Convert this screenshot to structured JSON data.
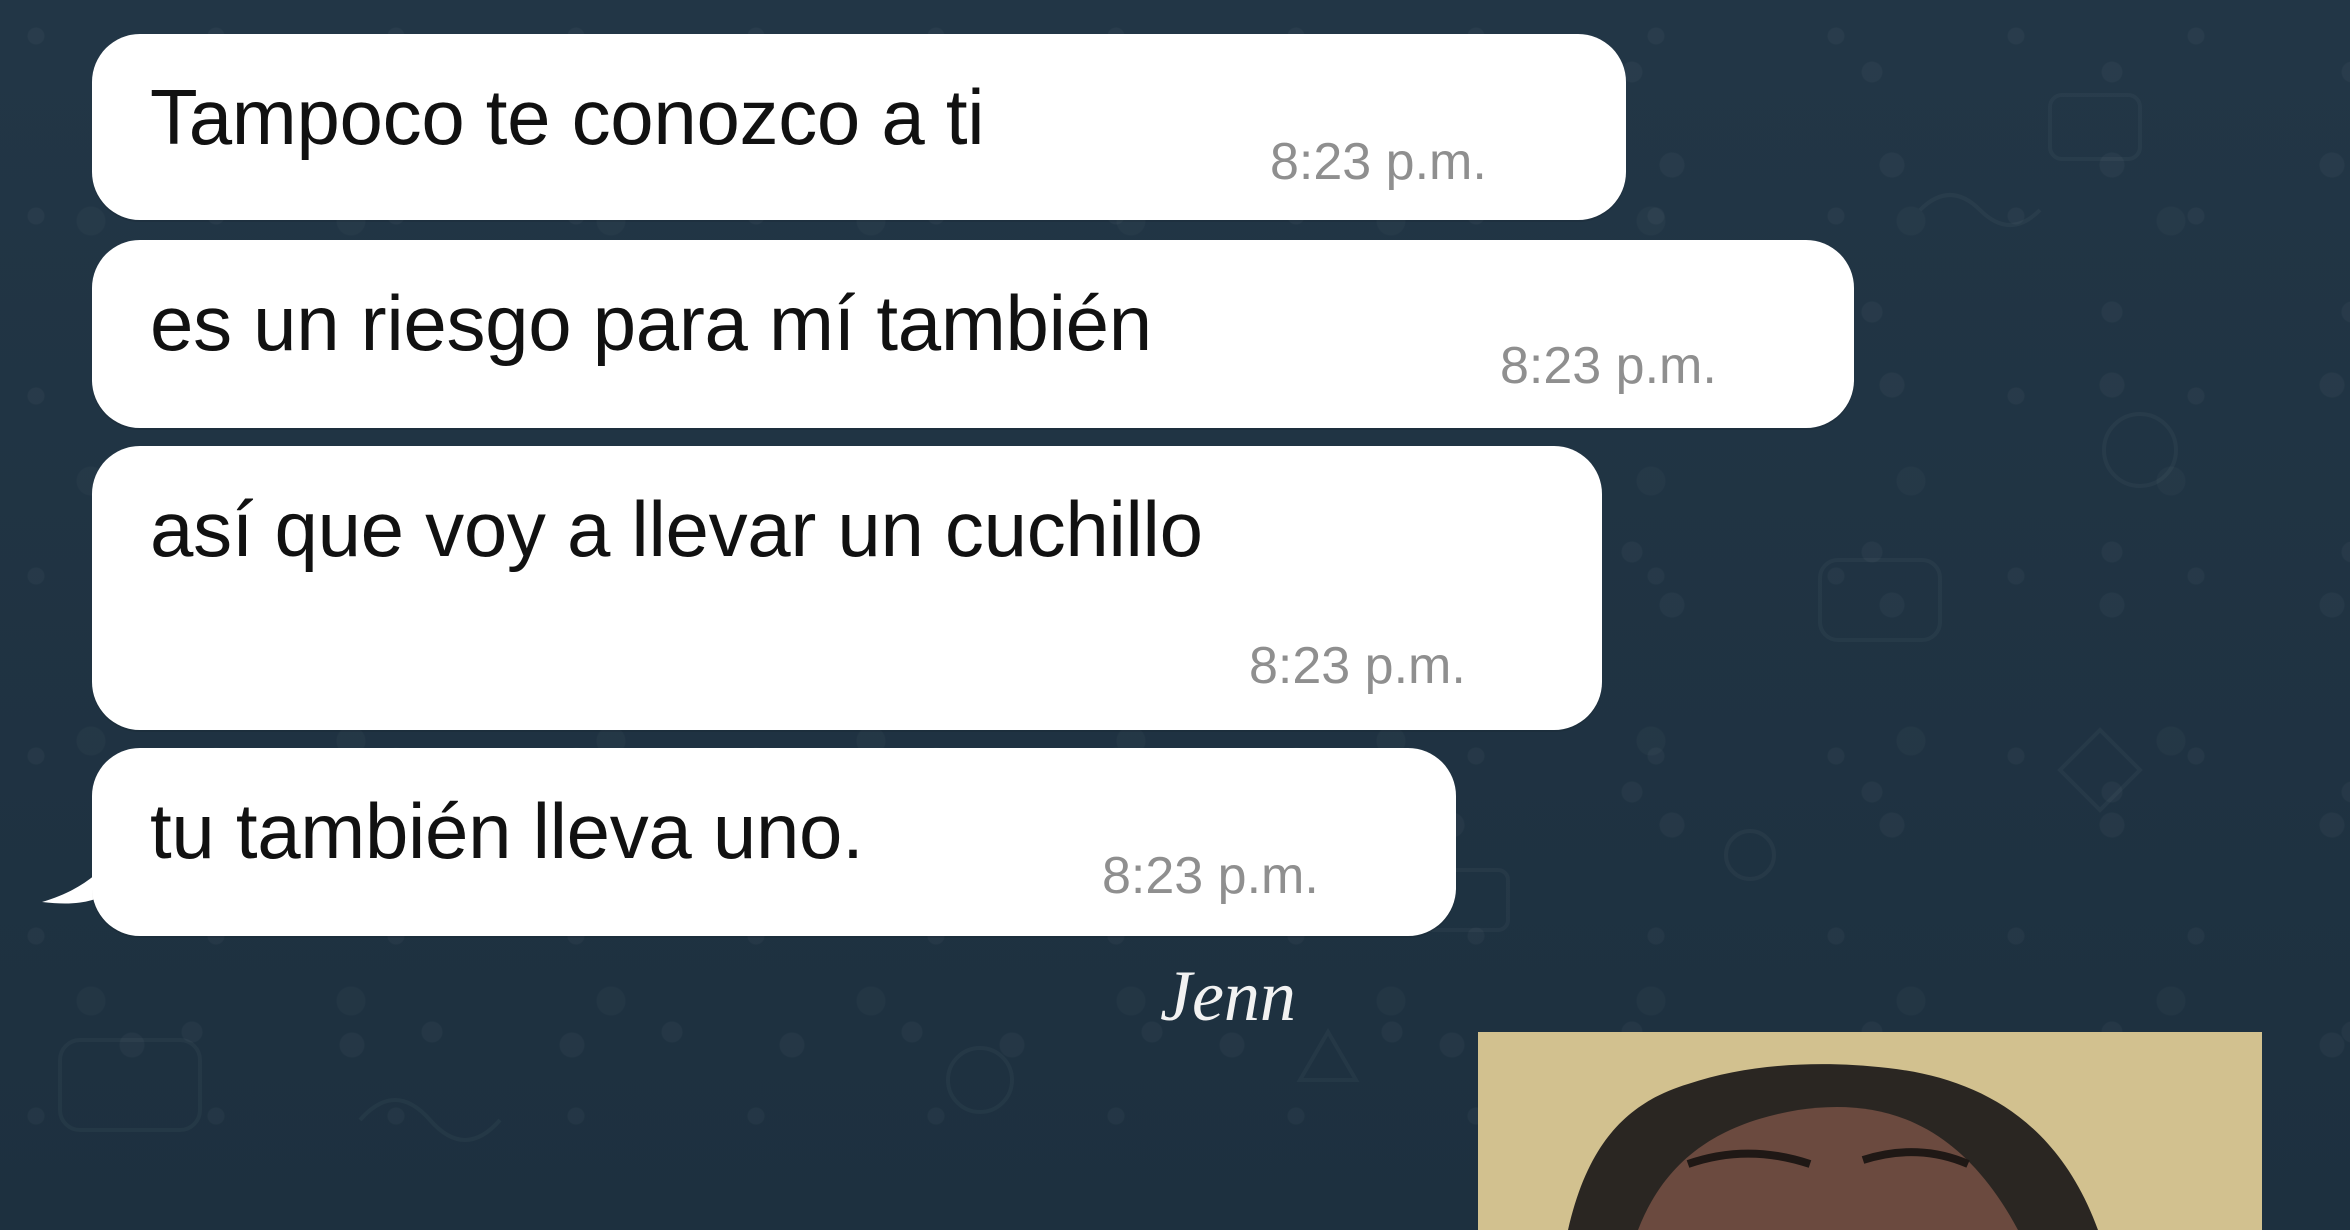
{
  "messages": [
    {
      "text": "Tampoco te conozco a ti",
      "time": "8:23 p.m."
    },
    {
      "text": "es un riesgo para mí también",
      "time": "8:23 p.m."
    },
    {
      "text": "así que voy a llevar un cuchillo",
      "time": "8:23 p.m."
    },
    {
      "text": "tu también lleva uno.",
      "time": "8:23 p.m."
    }
  ],
  "sender": {
    "name": "Jenn"
  },
  "colors": {
    "background": "#1f3242",
    "bubble": "#ffffff",
    "message_text": "#111111",
    "timestamp": "#8f8f8f",
    "sender_label": "#f2f2f2",
    "photo_background": "#d2c18f"
  }
}
